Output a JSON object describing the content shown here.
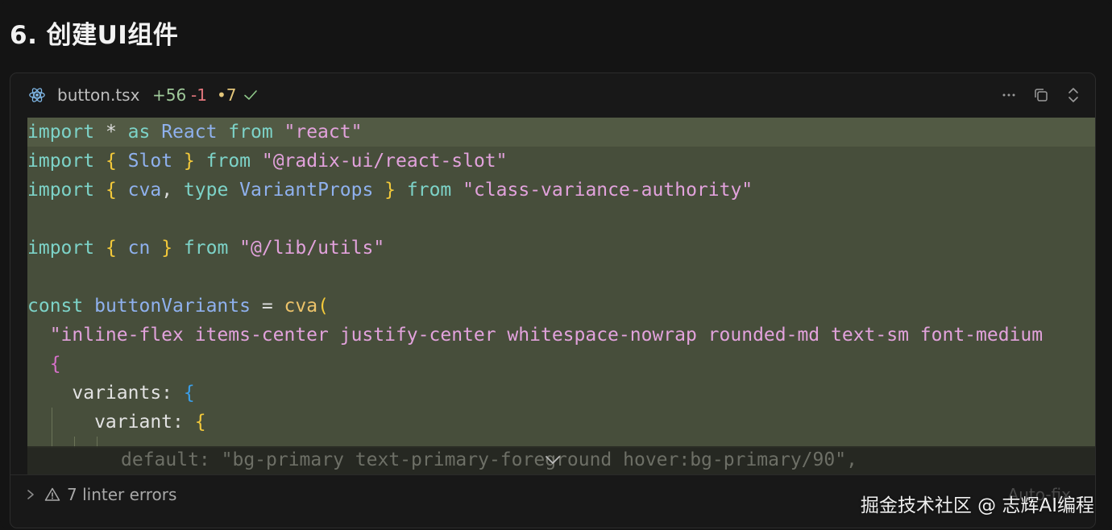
{
  "page": {
    "title": "6. 创建UI组件"
  },
  "file_header": {
    "file_name": "button.tsx",
    "additions": "+56",
    "deletions": "-1",
    "modified": "•7",
    "file_icon": "react-icon",
    "status_icon": "check-icon",
    "actions": [
      "more-icon",
      "copy-icon",
      "expand-collapse-icon"
    ]
  },
  "code": {
    "lines": [
      [
        {
          "t": "import",
          "c": "kw"
        },
        {
          "t": " * ",
          "c": "op"
        },
        {
          "t": "as",
          "c": "kw"
        },
        {
          "t": " React ",
          "c": "id"
        },
        {
          "t": "from",
          "c": "kw"
        },
        {
          "t": " \"react\"",
          "c": "str"
        }
      ],
      [
        {
          "t": "import",
          "c": "kw"
        },
        {
          "t": " ",
          "c": "op"
        },
        {
          "t": "{",
          "c": "br1"
        },
        {
          "t": " Slot ",
          "c": "id"
        },
        {
          "t": "}",
          "c": "br1"
        },
        {
          "t": " ",
          "c": "op"
        },
        {
          "t": "from",
          "c": "kw"
        },
        {
          "t": " \"@radix-ui/react-slot\"",
          "c": "str"
        }
      ],
      [
        {
          "t": "import",
          "c": "kw"
        },
        {
          "t": " ",
          "c": "op"
        },
        {
          "t": "{",
          "c": "br1"
        },
        {
          "t": " cva",
          "c": "id"
        },
        {
          "t": ", ",
          "c": "op"
        },
        {
          "t": "type",
          "c": "kw"
        },
        {
          "t": " VariantProps ",
          "c": "id"
        },
        {
          "t": "}",
          "c": "br1"
        },
        {
          "t": " ",
          "c": "op"
        },
        {
          "t": "from",
          "c": "kw"
        },
        {
          "t": " \"class-variance-authority\"",
          "c": "str"
        }
      ],
      [],
      [
        {
          "t": "import",
          "c": "kw"
        },
        {
          "t": " ",
          "c": "op"
        },
        {
          "t": "{",
          "c": "br1"
        },
        {
          "t": " cn ",
          "c": "id"
        },
        {
          "t": "}",
          "c": "br1"
        },
        {
          "t": " ",
          "c": "op"
        },
        {
          "t": "from",
          "c": "kw"
        },
        {
          "t": " \"@/lib/utils\"",
          "c": "str"
        }
      ],
      [],
      [
        {
          "t": "const",
          "c": "kw"
        },
        {
          "t": " buttonVariants ",
          "c": "id"
        },
        {
          "t": "=",
          "c": "op"
        },
        {
          "t": " cva",
          "c": "fn"
        },
        {
          "t": "(",
          "c": "br1"
        }
      ],
      [
        {
          "t": "  \"inline-flex items-center justify-center whitespace-nowrap rounded-md text-sm font-medium",
          "c": "str"
        }
      ],
      [
        {
          "t": "  ",
          "c": "op"
        },
        {
          "t": "{",
          "c": "br2"
        }
      ],
      [
        {
          "t": "    variants",
          "c": "plain"
        },
        {
          "t": ": ",
          "c": "op"
        },
        {
          "t": "{",
          "c": "br3"
        }
      ],
      [
        {
          "t": "      variant",
          "c": "plain"
        },
        {
          "t": ": ",
          "c": "op"
        },
        {
          "t": "{",
          "c": "br1"
        }
      ]
    ],
    "faded_line": "default: \"bg-primary text-primary-foreground hover:bg-primary/90\","
  },
  "footer": {
    "linter_label": "7 linter errors",
    "autofix_label": "Auto-fix"
  },
  "watermark": "掘金技术社区 @ 志辉AI编程"
}
